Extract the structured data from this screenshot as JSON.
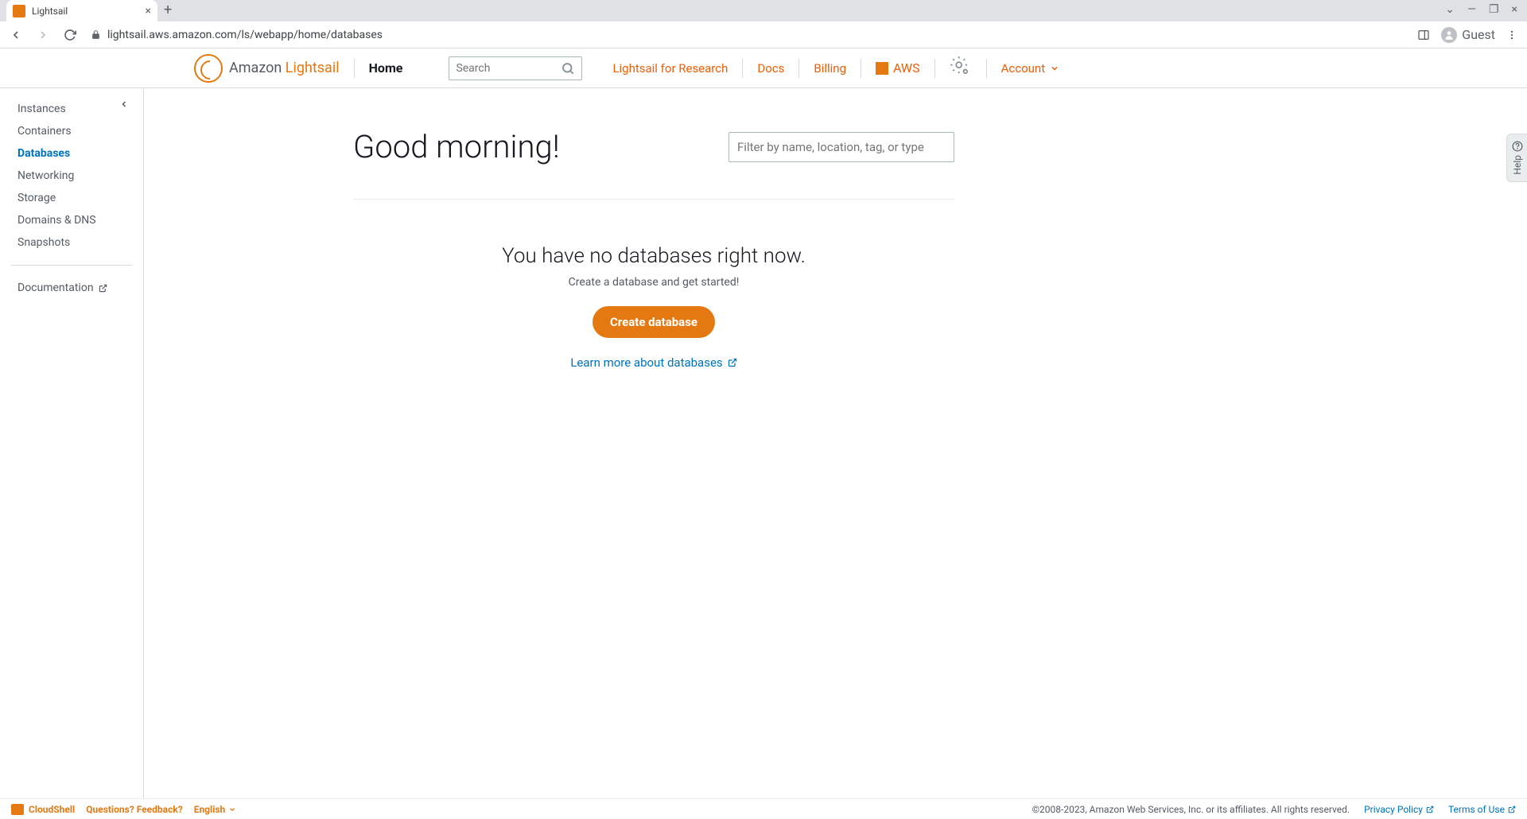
{
  "browser": {
    "tab_title": "Lightsail",
    "url": "lightsail.aws.amazon.com/ls/webapp/home/databases",
    "guest_label": "Guest"
  },
  "header": {
    "brand_prefix": "Amazon ",
    "brand_name": "Lightsail",
    "home_label": "Home",
    "search_placeholder": "Search",
    "nav": {
      "research": "Lightsail for Research",
      "docs": "Docs",
      "billing": "Billing",
      "aws": "AWS",
      "account": "Account"
    }
  },
  "sidebar": {
    "items": [
      {
        "label": "Instances",
        "active": false
      },
      {
        "label": "Containers",
        "active": false
      },
      {
        "label": "Databases",
        "active": true
      },
      {
        "label": "Networking",
        "active": false
      },
      {
        "label": "Storage",
        "active": false
      },
      {
        "label": "Domains & DNS",
        "active": false
      },
      {
        "label": "Snapshots",
        "active": false
      }
    ],
    "documentation_label": "Documentation"
  },
  "main": {
    "greeting": "Good morning!",
    "filter_placeholder": "Filter by name, location, tag, or type",
    "empty_title": "You have no databases right now.",
    "empty_subtitle": "Create a database and get started!",
    "create_button": "Create database",
    "learn_link": "Learn more about databases"
  },
  "help_tab": {
    "label": "Help"
  },
  "footer": {
    "cloudshell": "CloudShell",
    "feedback": "Questions? Feedback?",
    "language": "English",
    "copyright": "©2008-2023, Amazon Web Services, Inc. or its affiliates. All rights reserved.",
    "privacy": "Privacy Policy",
    "terms": "Terms of Use"
  }
}
